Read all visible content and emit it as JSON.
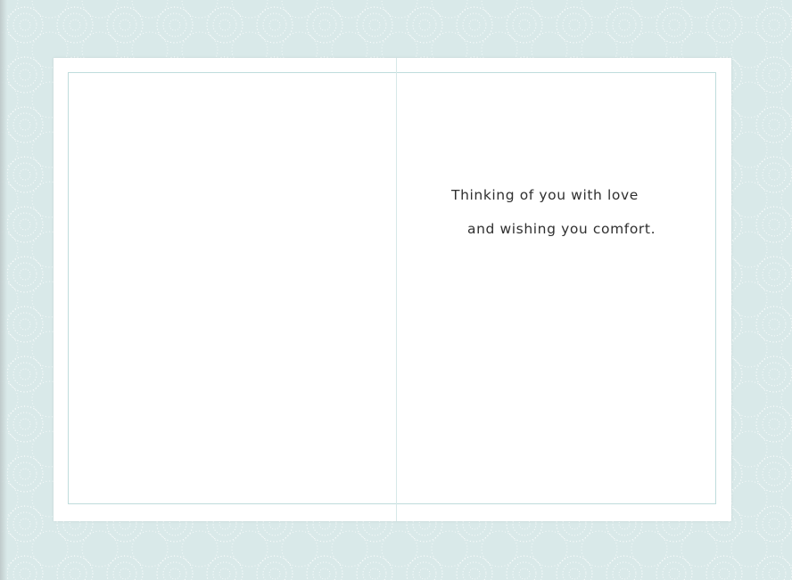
{
  "colors": {
    "background": "#d9e9e9",
    "pattern_dots": "#ffffff",
    "card": "#ffffff",
    "frame": "#bfdcdc",
    "text": "#2f2f2f"
  },
  "card": {
    "message_lines": [
      "Thinking of you with love",
      "and wishing you comfort."
    ]
  }
}
